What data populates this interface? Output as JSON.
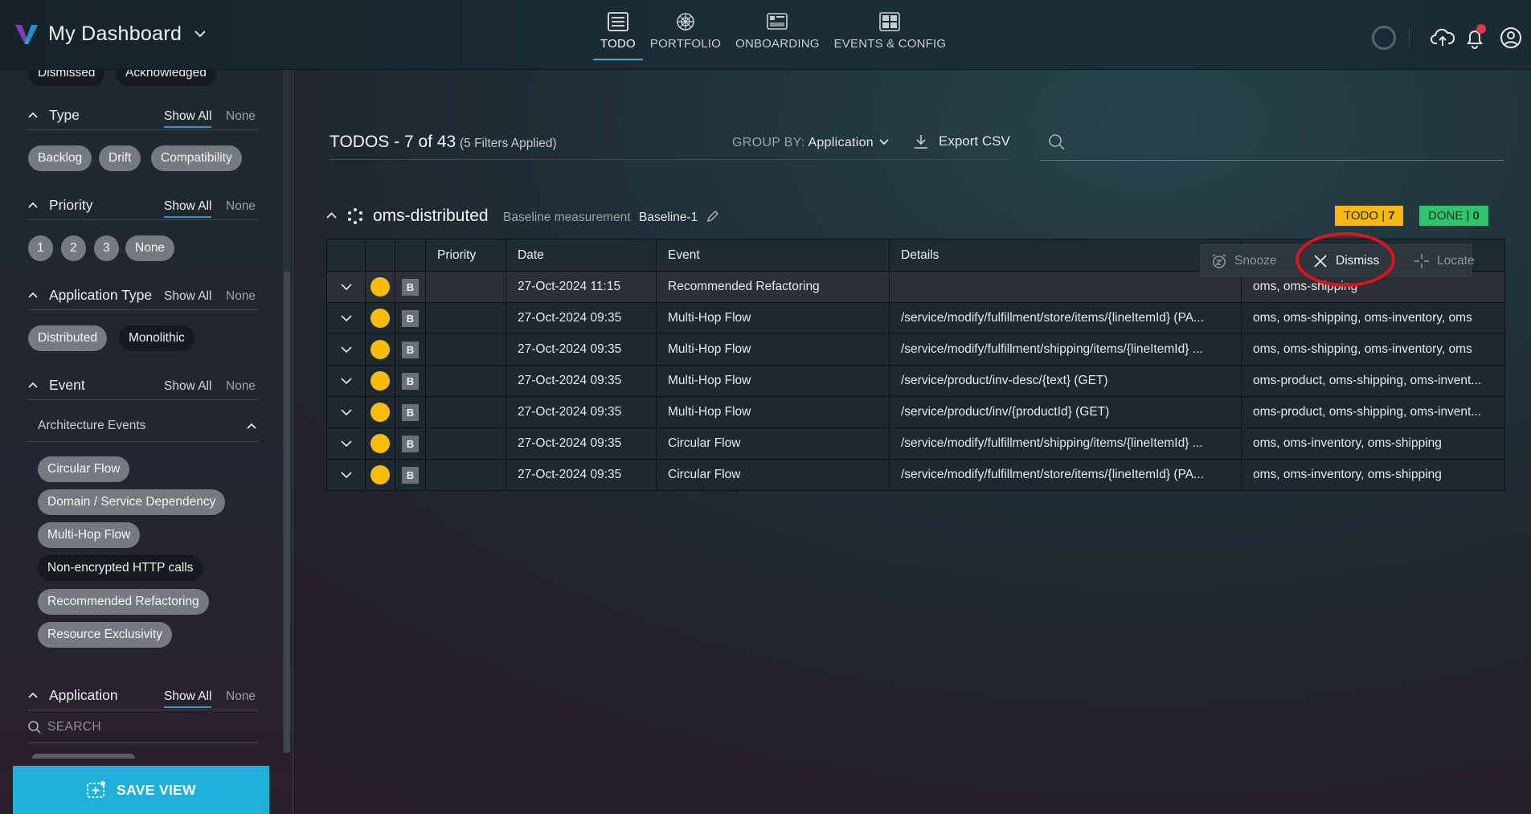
{
  "app": {
    "title": "My Dashboard",
    "accent": "#1fb0d8"
  },
  "nav": {
    "tabs": [
      {
        "label": "TODO",
        "icon": "list-icon",
        "active": true
      },
      {
        "label": "PORTFOLIO",
        "icon": "portfolio-icon",
        "active": false
      },
      {
        "label": "ONBOARDING",
        "icon": "onboarding-icon",
        "active": false
      },
      {
        "label": "EVENTS & CONFIG",
        "icon": "grid-icon",
        "active": false
      }
    ]
  },
  "sidebar": {
    "status_chips": [
      "Dismissed",
      "Acknowledged"
    ],
    "show_all": "Show All",
    "none": "None",
    "type": {
      "title": "Type",
      "chips": [
        "Backlog",
        "Drift",
        "Compatibility"
      ]
    },
    "priority": {
      "title": "Priority",
      "chips": [
        "1",
        "2",
        "3",
        "None"
      ]
    },
    "app_type": {
      "title": "Application Type",
      "chips": [
        "Distributed",
        "Monolithic"
      ]
    },
    "event": {
      "title": "Event",
      "subsection": "Architecture Events",
      "chips": [
        "Circular Flow",
        "Domain / Service Dependency",
        "Multi-Hop Flow",
        "Non-encrypted HTTP calls",
        "Recommended Refactoring",
        "Resource Exclusivity"
      ]
    },
    "application": {
      "title": "Application",
      "search_placeholder": "SEARCH"
    },
    "save_view": "SAVE VIEW"
  },
  "main": {
    "title": "TODOS - 7 of 43",
    "filters_applied": "(5 Filters Applied)",
    "group_by_label": "GROUP BY:",
    "group_by_value": "Application",
    "export": "Export CSV",
    "search_value": ""
  },
  "group": {
    "name": "oms-distributed",
    "baseline_label": "Baseline measurement",
    "baseline_name": "Baseline-1",
    "todo_label": "TODO |",
    "todo_count": "7",
    "done_label": "DONE |",
    "done_count": "0"
  },
  "table": {
    "headers": {
      "priority": "Priority",
      "date": "Date",
      "event": "Event",
      "details": "Details"
    },
    "badge_letter": "B",
    "rows": [
      {
        "date": "27-Oct-2024 11:15",
        "event": "Recommended Refactoring",
        "details": "",
        "apps": "oms, oms-shipping"
      },
      {
        "date": "27-Oct-2024 09:35",
        "event": "Multi-Hop Flow",
        "details": "/service/modify/fulfillment/store/items/{lineItemId} (PA...",
        "apps": "oms, oms-shipping, oms-inventory, oms"
      },
      {
        "date": "27-Oct-2024 09:35",
        "event": "Multi-Hop Flow",
        "details": "/service/modify/fulfillment/shipping/items/{lineItemId} ...",
        "apps": "oms, oms-shipping, oms-inventory, oms"
      },
      {
        "date": "27-Oct-2024 09:35",
        "event": "Multi-Hop Flow",
        "details": "/service/product/inv-desc/{text} (GET)",
        "apps": "oms-product, oms-shipping, oms-invent..."
      },
      {
        "date": "27-Oct-2024 09:35",
        "event": "Multi-Hop Flow",
        "details": "/service/product/inv/{productId} (GET)",
        "apps": "oms-product, oms-shipping, oms-invent..."
      },
      {
        "date": "27-Oct-2024 09:35",
        "event": "Circular Flow",
        "details": "/service/modify/fulfillment/shipping/items/{lineItemId} ...",
        "apps": "oms, oms-inventory, oms-shipping"
      },
      {
        "date": "27-Oct-2024 09:35",
        "event": "Circular Flow",
        "details": "/service/modify/fulfillment/store/items/{lineItemId} (PA...",
        "apps": "oms, oms-inventory, oms-shipping"
      }
    ]
  },
  "row_actions": {
    "snooze": "Snooze",
    "dismiss": "Dismiss",
    "locate": "Locate"
  }
}
